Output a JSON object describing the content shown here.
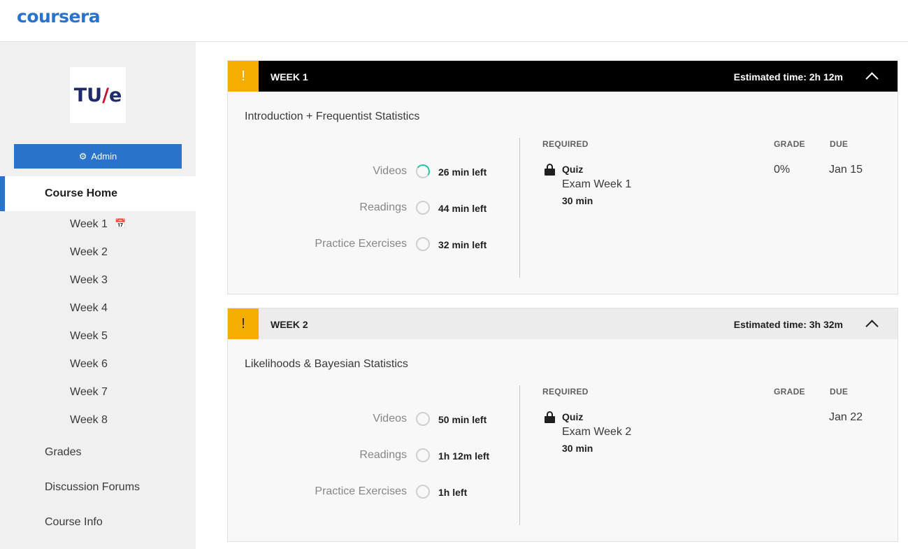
{
  "app": {
    "logo": "coursera"
  },
  "sidebar": {
    "university_logo": {
      "text_left": "TU",
      "text_slash": "/",
      "text_right": "e"
    },
    "admin_button": "Admin",
    "course_home": "Course Home",
    "weeks": [
      "Week 1",
      "Week 2",
      "Week 3",
      "Week 4",
      "Week 5",
      "Week 6",
      "Week 7",
      "Week 8"
    ],
    "links": [
      "Grades",
      "Discussion Forums",
      "Course Info"
    ]
  },
  "weeks": [
    {
      "label": "WEEK 1",
      "estimated": "Estimated time: 2h 12m",
      "title": "Introduction + Frequentist Statistics",
      "items": [
        {
          "label": "Videos",
          "left": "26 min left",
          "progress": 0.3
        },
        {
          "label": "Readings",
          "left": "44 min left",
          "progress": 0
        },
        {
          "label": "Practice Exercises",
          "left": "32 min left",
          "progress": 0
        }
      ],
      "required_header": "REQUIRED",
      "grade_header": "GRADE",
      "due_header": "DUE",
      "assignment": {
        "type": "Quiz",
        "name": "Exam Week 1",
        "duration": "30 min",
        "grade": "0%",
        "due": "Jan 15"
      }
    },
    {
      "label": "WEEK 2",
      "estimated": "Estimated time: 3h 32m",
      "title": "Likelihoods & Bayesian Statistics",
      "items": [
        {
          "label": "Videos",
          "left": "50 min left",
          "progress": 0
        },
        {
          "label": "Readings",
          "left": "1h 12m left",
          "progress": 0
        },
        {
          "label": "Practice Exercises",
          "left": "1h left",
          "progress": 0
        }
      ],
      "required_header": "REQUIRED",
      "grade_header": "GRADE",
      "due_header": "DUE",
      "assignment": {
        "type": "Quiz",
        "name": "Exam Week 2",
        "duration": "30 min",
        "grade": "",
        "due": "Jan 22"
      }
    }
  ],
  "colors": {
    "brand": "#2a73cc",
    "warning": "#f5ad00",
    "progress": "#21c5a2",
    "calendar": "#e05569"
  }
}
